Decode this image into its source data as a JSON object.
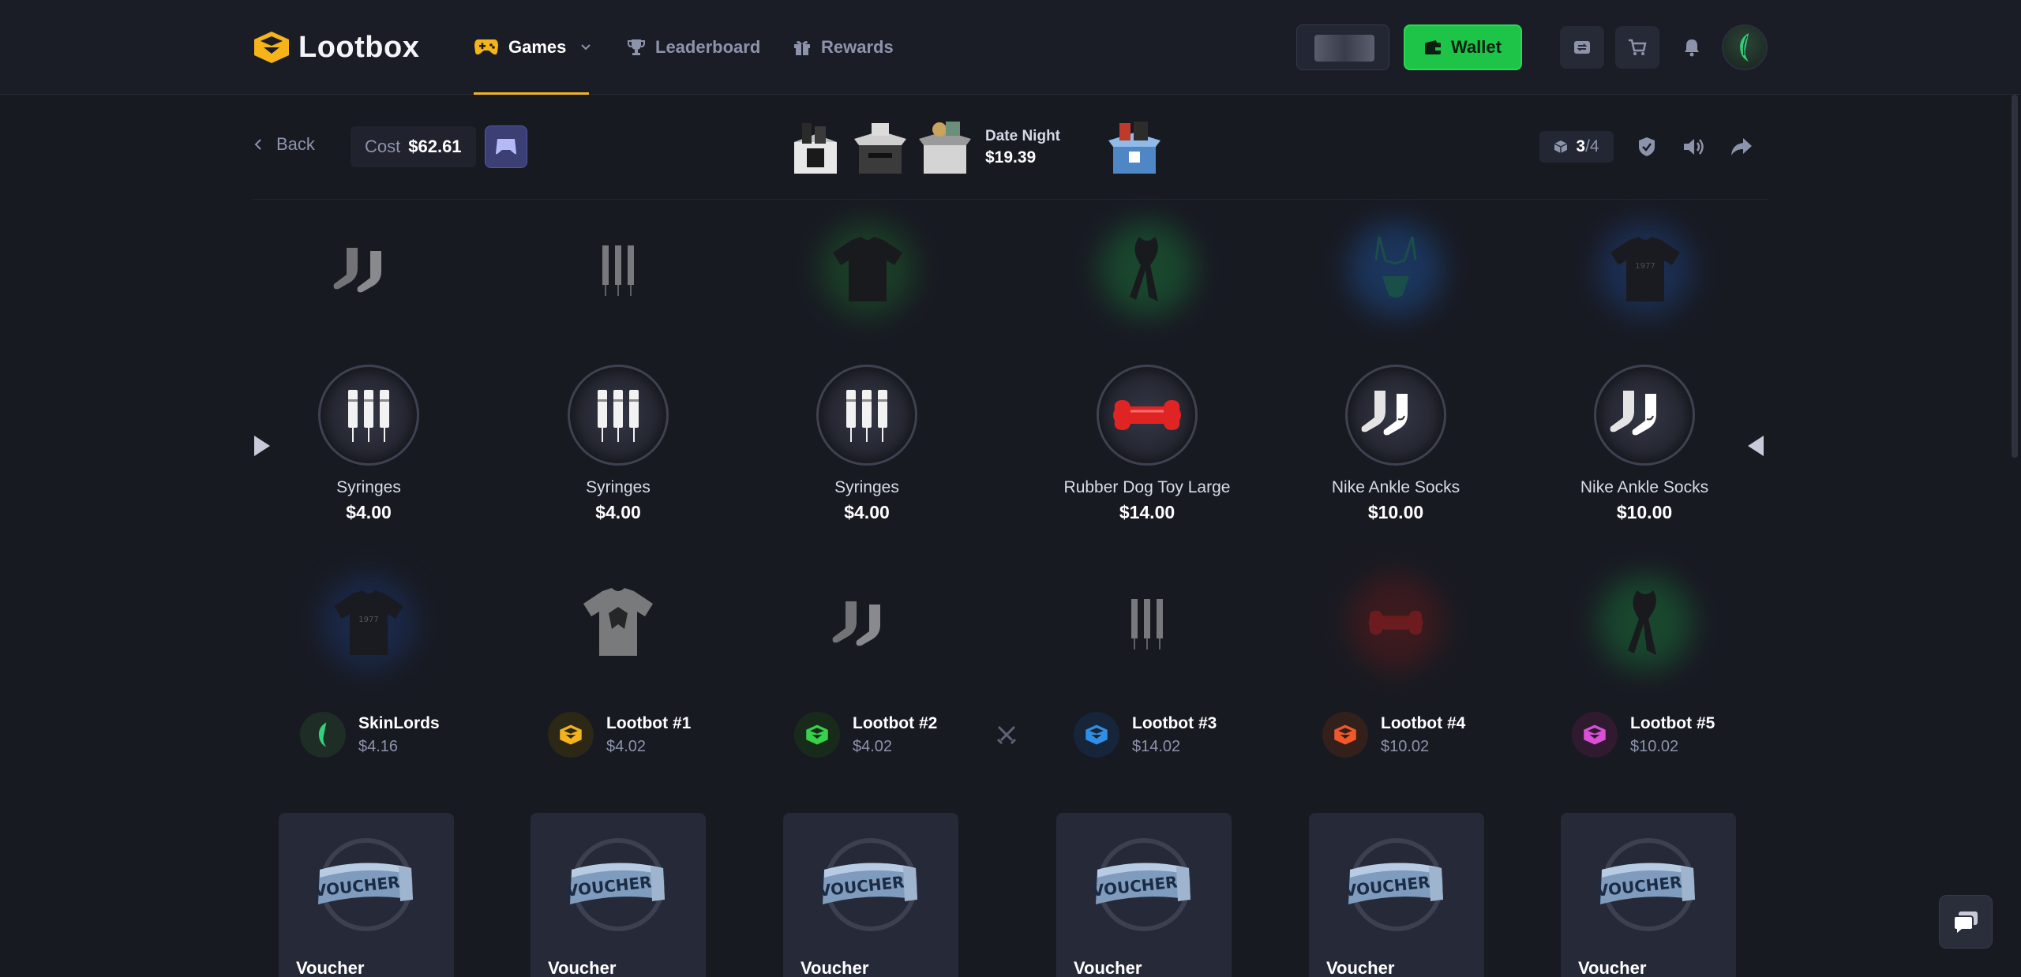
{
  "brand": {
    "name": "Lootbox"
  },
  "nav": {
    "games": "Games",
    "leaderboard": "Leaderboard",
    "rewards": "Rewards",
    "wallet": "Wallet"
  },
  "subbar": {
    "back": "Back",
    "cost_label": "Cost",
    "cost_value": "$62.61",
    "box_name": "Date Night",
    "box_price": "$19.39",
    "counter_current": "3",
    "counter_separator": "/",
    "counter_total": "4"
  },
  "reel": {
    "items": [
      {
        "name": "Syringes",
        "price": "$4.00",
        "icon": "syringes-icon"
      },
      {
        "name": "Syringes",
        "price": "$4.00",
        "icon": "syringes-icon"
      },
      {
        "name": "Syringes",
        "price": "$4.00",
        "icon": "syringes-icon"
      },
      {
        "name": "Rubber Dog Toy Large",
        "price": "$14.00",
        "icon": "dog-bone-icon"
      },
      {
        "name": "Nike Ankle Socks",
        "price": "$10.00",
        "icon": "socks-icon"
      },
      {
        "name": "Nike Ankle Socks",
        "price": "$10.00",
        "icon": "socks-icon"
      }
    ]
  },
  "players": [
    {
      "name": "SkinLords",
      "value": "$4.16",
      "color": "#2a3b33"
    },
    {
      "name": "Lootbot #1",
      "value": "$4.02",
      "color": "#f2b31c"
    },
    {
      "name": "Lootbot #2",
      "value": "$4.02",
      "color": "#37d14a"
    },
    {
      "name": "Lootbot #3",
      "value": "$14.02",
      "color": "#2f8ee6"
    },
    {
      "name": "Lootbot #4",
      "value": "$10.02",
      "color": "#f0582a"
    },
    {
      "name": "Lootbot #5",
      "value": "$10.02",
      "color": "#d94fd6"
    }
  ],
  "cards": [
    {
      "name": "Voucher"
    },
    {
      "name": "Voucher"
    },
    {
      "name": "Voucher"
    },
    {
      "name": "Voucher"
    },
    {
      "name": "Voucher"
    },
    {
      "name": "Voucher"
    }
  ],
  "colors": {
    "background": "#181a22",
    "accent": "#f0b429",
    "wallet": "#1ec447"
  }
}
